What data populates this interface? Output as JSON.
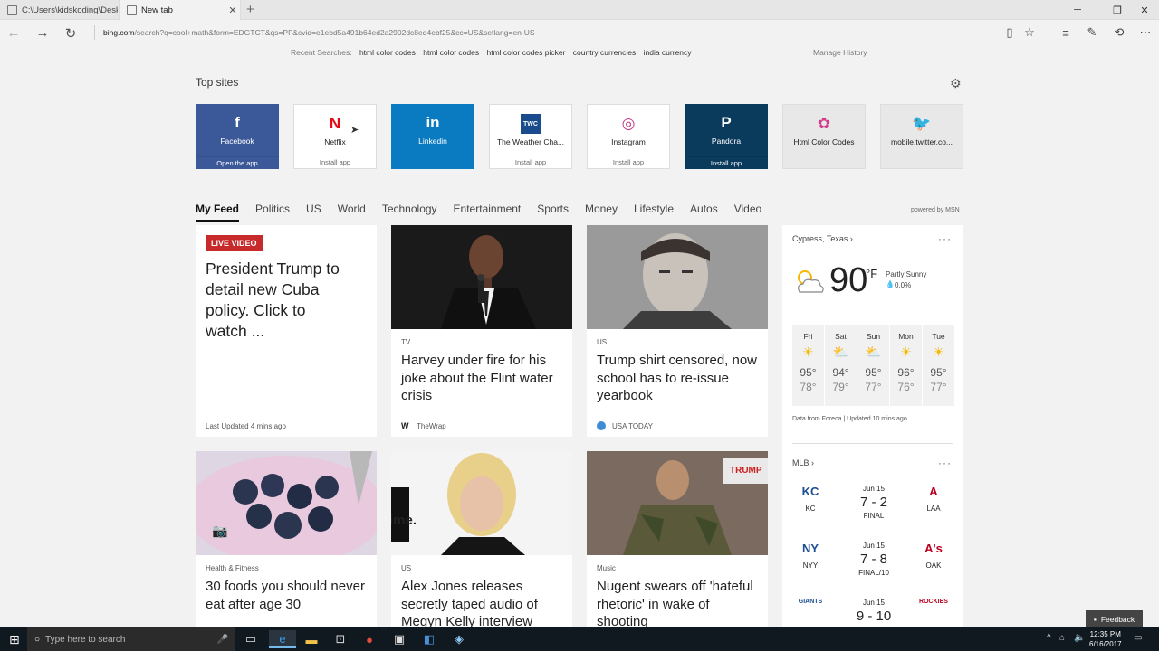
{
  "browser": {
    "tabs": [
      {
        "label": "C:\\Users\\kidskoding\\Desktop",
        "active": false
      },
      {
        "label": "New tab",
        "active": true
      }
    ],
    "url_host": "bing.com",
    "url_path": "/search?q=cool+math&form=EDGTCT&qs=PF&cvid=e1ebd5a491b64ed2a2902dc8ed4ebf25&cc=US&setlang=en-US"
  },
  "recent": {
    "label": "Recent Searches:",
    "items": [
      "html color codes",
      "html color codes",
      "html color codes picker",
      "country currencies",
      "india currency"
    ],
    "manage": "Manage History"
  },
  "top_sites": {
    "title": "Top sites",
    "sites": [
      {
        "name": "Facebook",
        "action": "Open the app",
        "bg": "#3b5998",
        "fg": "#ffffff",
        "glyph": "f",
        "glyph_color": "#ffffff"
      },
      {
        "name": "Netflix",
        "action": "Install app",
        "bg": "#ffffff",
        "fg": "#222222",
        "glyph": "N",
        "glyph_color": "#e50914"
      },
      {
        "name": "Linkedin",
        "action": "",
        "bg": "#0a7bc1",
        "fg": "#ffffff",
        "glyph": "in",
        "glyph_color": "#ffffff"
      },
      {
        "name": "The Weather Cha...",
        "action": "Install app",
        "bg": "#ffffff",
        "fg": "#222222",
        "glyph": "TWC",
        "glyph_color": "#1a4b8c"
      },
      {
        "name": "Instagram",
        "action": "Install app",
        "bg": "#ffffff",
        "fg": "#222222",
        "glyph": "◎",
        "glyph_color": "#c13584"
      },
      {
        "name": "Pandora",
        "action": "Install app",
        "bg": "#0a3a5c",
        "fg": "#ffffff",
        "glyph": "P",
        "glyph_color": "#ffffff"
      },
      {
        "name": "Html Color Codes",
        "action": "",
        "bg": "#e8e8e8",
        "fg": "#222222",
        "glyph": "✿",
        "glyph_color": "#d23c8b"
      },
      {
        "name": "mobile.twitter.co...",
        "action": "",
        "bg": "#e8e8e8",
        "fg": "#222222",
        "glyph": "🐦",
        "glyph_color": "#1da1f2"
      }
    ]
  },
  "feed_nav": {
    "items": [
      "My Feed",
      "Politics",
      "US",
      "World",
      "Technology",
      "Entertainment",
      "Sports",
      "Money",
      "Lifestyle",
      "Autos",
      "Video"
    ],
    "selected": "My Feed",
    "powered": "powered by MSN"
  },
  "cards": [
    {
      "badge": "LIVE VIDEO",
      "head": "President Trump to detail new Cuba policy. Click to watch ...",
      "src": "Last Updated 4 mins ago"
    },
    {
      "cat": "TV",
      "head": "Harvey under fire for his joke about the Flint water crisis",
      "src": "TheWrap"
    },
    {
      "cat": "US",
      "head": "Trump shirt censored, now school has to re-issue yearbook",
      "src": "USA TODAY"
    },
    {
      "cat": "Health & Fitness",
      "head": "30 foods you should never eat after age 30"
    },
    {
      "cat": "US",
      "head": "Alex Jones releases secretly taped audio of Megyn Kelly interview"
    },
    {
      "cat": "Music",
      "head": "Nugent swears off 'hateful rhetoric' in wake of shooting",
      "img_text": "TRUMP"
    }
  ],
  "weather": {
    "location": "Cypress, Texas",
    "temp": "90",
    "unit": "°F",
    "condition": "Partly Sunny",
    "precip": "0.0%",
    "days": [
      {
        "name": "Fri",
        "icon": "☀",
        "hi": "95°",
        "lo": "78°"
      },
      {
        "name": "Sat",
        "icon": "⛅",
        "hi": "94°",
        "lo": "79°"
      },
      {
        "name": "Sun",
        "icon": "⛅",
        "hi": "95°",
        "lo": "77°"
      },
      {
        "name": "Mon",
        "icon": "☀",
        "hi": "96°",
        "lo": "76°"
      },
      {
        "name": "Tue",
        "icon": "☀",
        "hi": "95°",
        "lo": "77°"
      }
    ],
    "source": "Data from Foreca | Updated 10 mins ago"
  },
  "mlb": {
    "title": "MLB",
    "games": [
      {
        "date": "Jun 15",
        "score": "7 - 2",
        "status": "FINAL",
        "away": "KC",
        "home": "LAA",
        "away_logo": "KC",
        "home_logo": "A"
      },
      {
        "date": "Jun 15",
        "score": "7 - 8",
        "status": "FINAL/10",
        "away": "NYY",
        "home": "OAK",
        "away_logo": "NY",
        "home_logo": "A's"
      },
      {
        "date": "Jun 15",
        "score": "9 - 10",
        "status": "",
        "away": "",
        "home": "",
        "away_logo": "GIANTS",
        "home_logo": "ROCKIES"
      }
    ]
  },
  "feedback": "Feedback",
  "taskbar": {
    "search_placeholder": "Type here to search",
    "time": "12:35 PM",
    "date": "6/16/2017"
  }
}
